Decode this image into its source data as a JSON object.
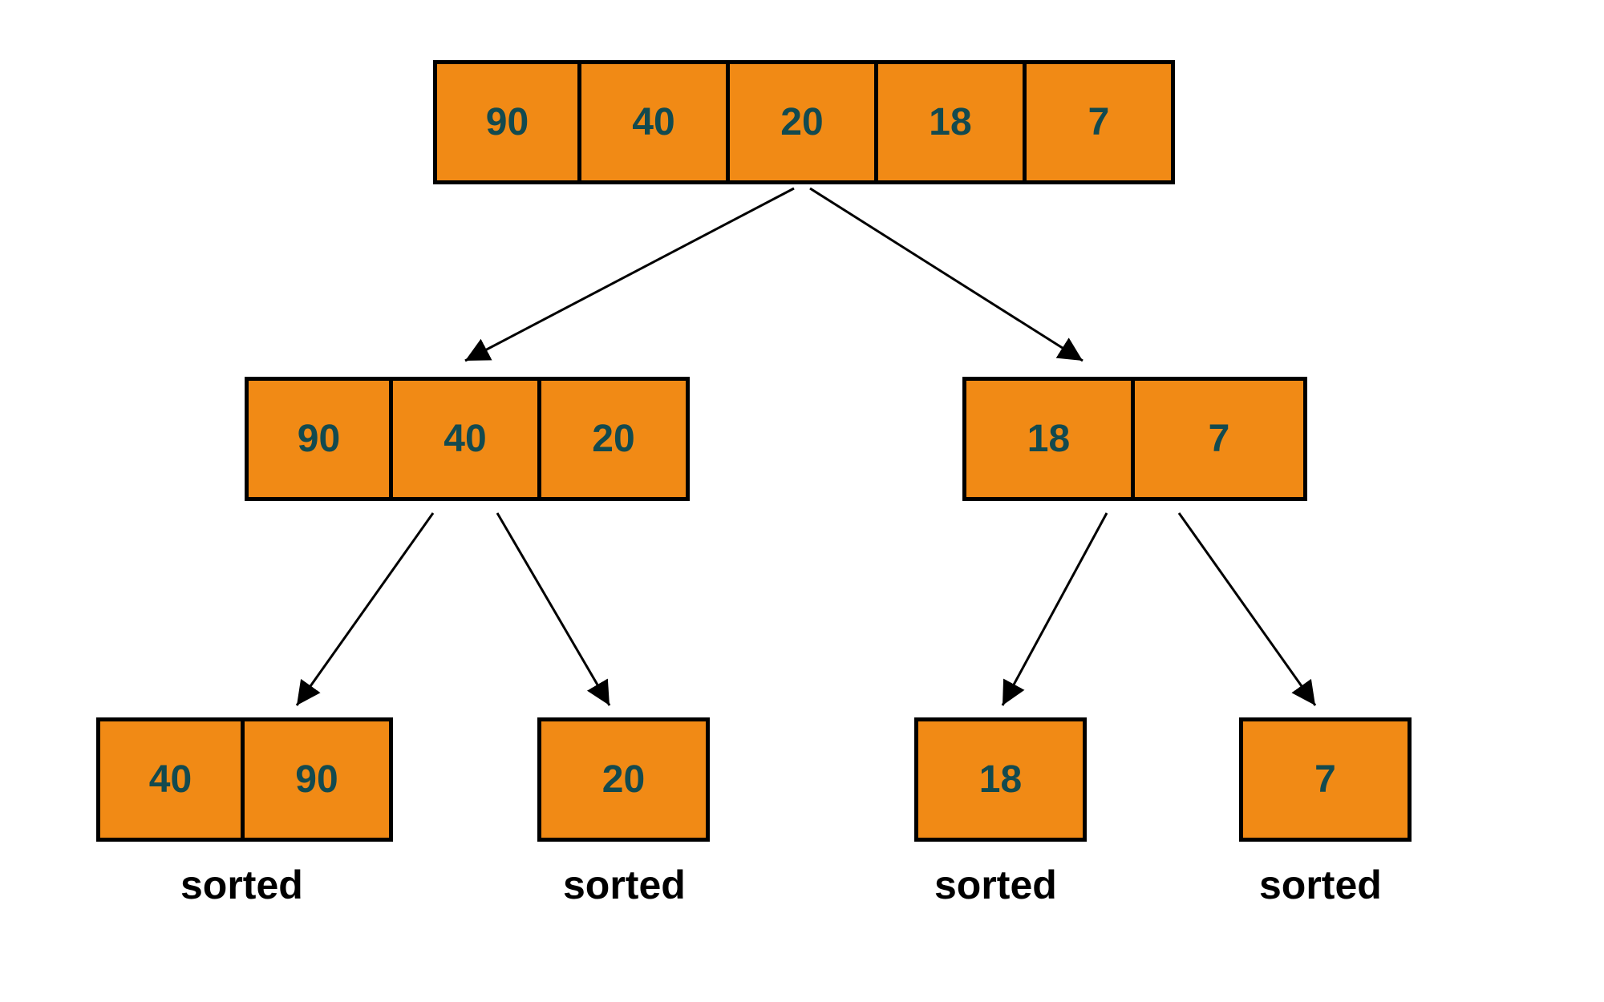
{
  "level0": {
    "values": [
      "90",
      "40",
      "20",
      "18",
      "7"
    ]
  },
  "level1": {
    "left": {
      "values": [
        "90",
        "40",
        "20"
      ]
    },
    "right": {
      "values": [
        "18",
        "7"
      ]
    }
  },
  "level2": {
    "a": {
      "values": [
        "40",
        "90"
      ],
      "label": "sorted"
    },
    "b": {
      "values": [
        "20"
      ],
      "label": "sorted"
    },
    "c": {
      "values": [
        "18"
      ],
      "label": "sorted"
    },
    "d": {
      "values": [
        "7"
      ],
      "label": "sorted"
    }
  },
  "colors": {
    "cell_fill": "#f18a15",
    "cell_text": "#134a4f",
    "border": "#000000"
  }
}
